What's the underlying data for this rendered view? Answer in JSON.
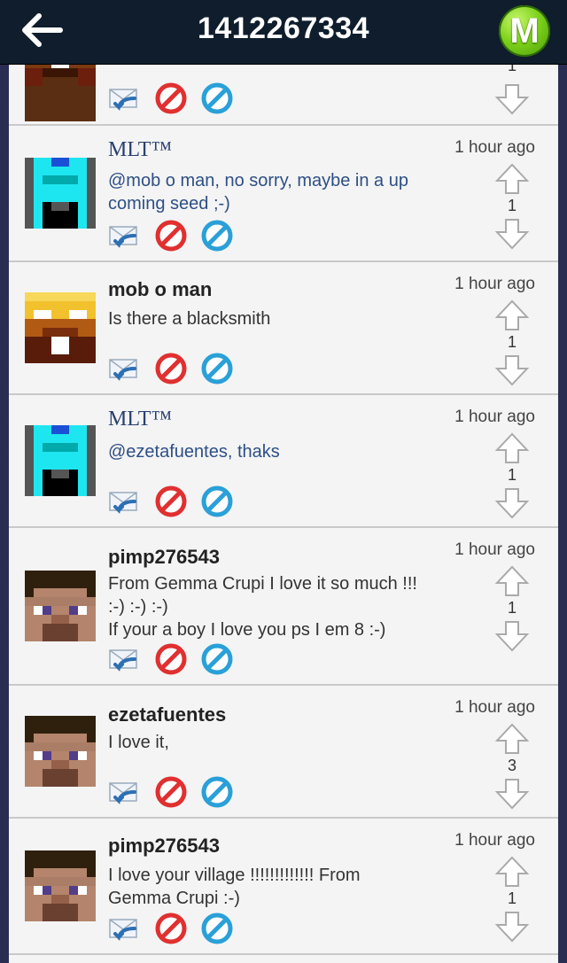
{
  "header": {
    "back_icon": "back-arrow-icon",
    "title": "1412267334",
    "logo_letter": "M",
    "logo_color": "#7dd21a"
  },
  "colors": {
    "reply": "#2d6fb3",
    "block": "#e03030",
    "report": "#2aa0d8",
    "header_bg": "#0f1d2c"
  },
  "partial_item": {
    "score": "1"
  },
  "comments": [
    {
      "author": "MLT™",
      "time": "1 hour ago",
      "score": "1",
      "text": "@mob o man, no sorry, maybe in a up coming seed ;-)",
      "avatar": "diamond-armor-avatar"
    },
    {
      "author": "mob o man",
      "time": "1 hour ago",
      "score": "1",
      "text": "Is there a blacksmith",
      "avatar": "gold-mob-avatar"
    },
    {
      "author": "MLT™",
      "time": "1 hour ago",
      "score": "1",
      "text": "@ezetafuentes, thaks",
      "avatar": "diamond-armor-avatar"
    },
    {
      "author": "pimp276543",
      "time": "1 hour ago",
      "score": "1",
      "text": "From Gemma Crupi I love it so much !!! :-) :-) :-)\nIf your a boy I love you ps I em 8 :-)",
      "avatar": "steve-avatar"
    },
    {
      "author": "ezetafuentes",
      "time": "1 hour ago",
      "score": "3",
      "text": "I love it,",
      "avatar": "steve-avatar"
    },
    {
      "author": "pimp276543",
      "time": "1 hour ago",
      "score": "1",
      "text": "I love your village !!!!!!!!!!!!! From Gemma Crupi :-)",
      "avatar": "steve-avatar"
    }
  ]
}
